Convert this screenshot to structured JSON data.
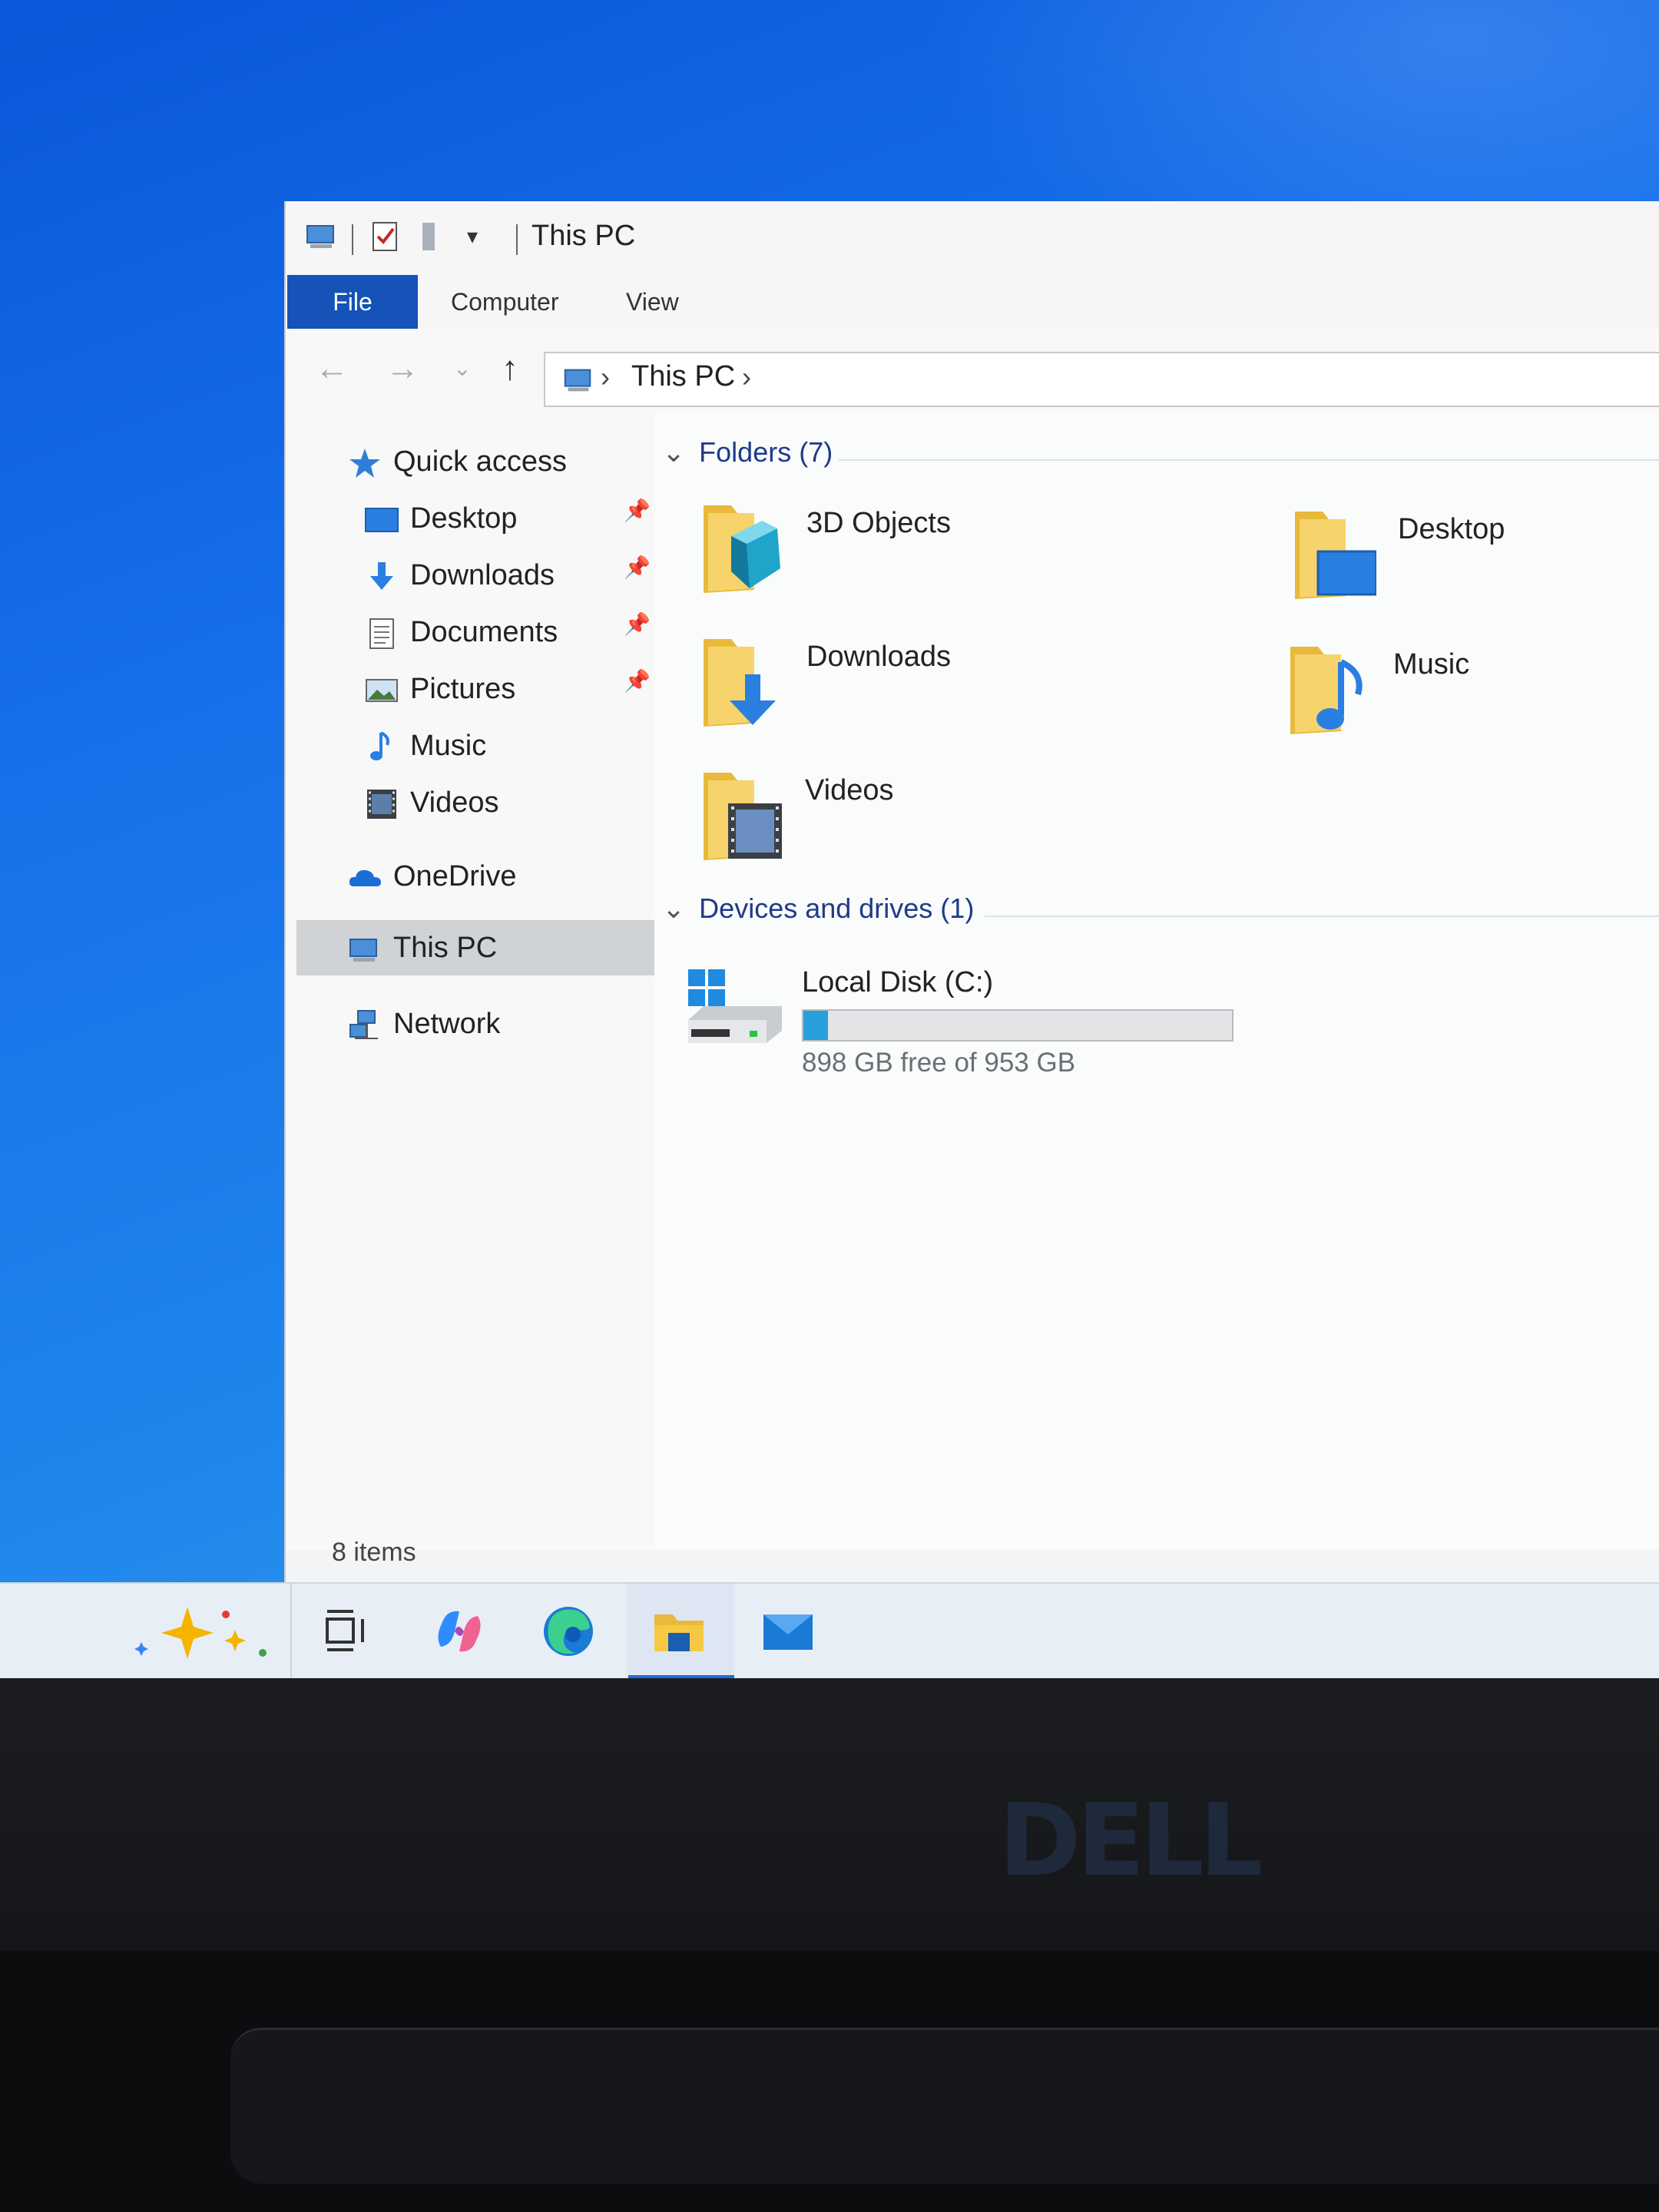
{
  "window": {
    "title": "This PC",
    "ribbon_tabs": [
      "File",
      "Computer",
      "View"
    ],
    "address": {
      "path": "This PC"
    }
  },
  "nav": {
    "quick_access": "Quick access",
    "items": [
      {
        "label": "Desktop",
        "icon": "desktop-icon",
        "pinned": true
      },
      {
        "label": "Downloads",
        "icon": "downloads-icon",
        "pinned": true
      },
      {
        "label": "Documents",
        "icon": "documents-icon",
        "pinned": true
      },
      {
        "label": "Pictures",
        "icon": "pictures-icon",
        "pinned": true
      },
      {
        "label": "Music",
        "icon": "music-icon",
        "pinned": false
      },
      {
        "label": "Videos",
        "icon": "videos-icon",
        "pinned": false
      }
    ],
    "onedrive": "OneDrive",
    "this_pc": "This PC",
    "network": "Network"
  },
  "content": {
    "folders_header": "Folders (7)",
    "folders": [
      {
        "label": "3D Objects",
        "icon": "3d-objects-icon"
      },
      {
        "label": "Desktop",
        "icon": "desktop-icon"
      },
      {
        "label": "Downloads",
        "icon": "downloads-icon"
      },
      {
        "label": "Music",
        "icon": "music-icon"
      },
      {
        "label": "Videos",
        "icon": "videos-icon"
      }
    ],
    "devices_header": "Devices and drives (1)",
    "drive": {
      "label": "Local Disk (C:)",
      "free_text": "898 GB free of 953 GB",
      "used_fraction": 0.058,
      "bar_color": "#26a0da"
    }
  },
  "status": {
    "items": "8 items"
  },
  "taskbar": {
    "icons": [
      "copilot-sparkle-icon",
      "task-view-icon",
      "copilot-icon",
      "edge-icon",
      "file-explorer-icon",
      "mail-icon"
    ]
  },
  "brand": {
    "logo_text": "DELL"
  },
  "colors": {
    "accent": "#1553b8",
    "desktop_blue": "#1670ea",
    "folder_yellow": "#f2c94c"
  }
}
